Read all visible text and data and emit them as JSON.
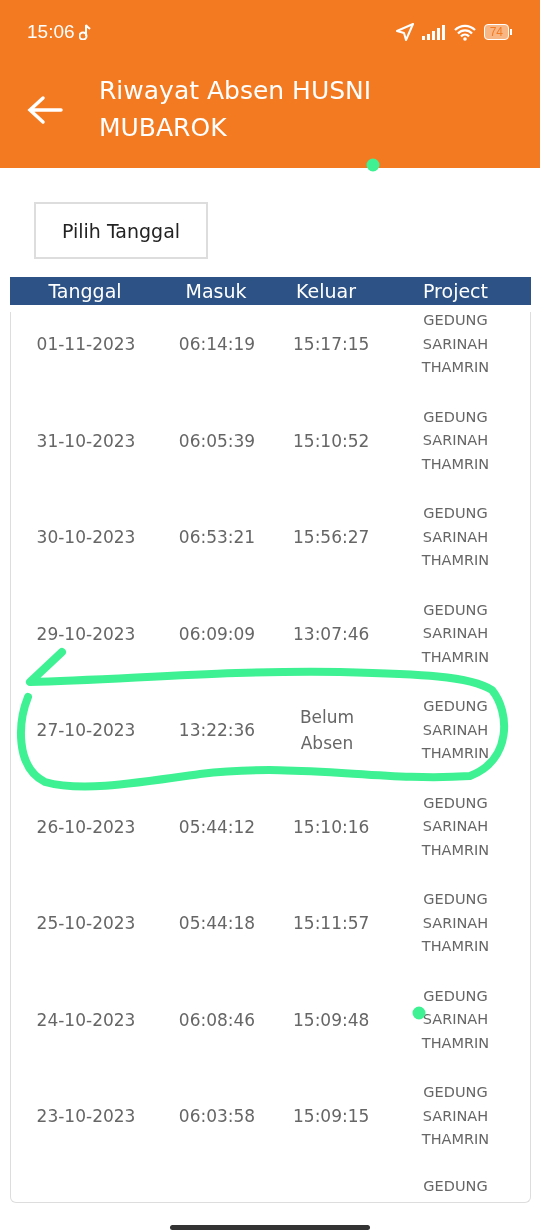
{
  "status_bar": {
    "time": "15:06",
    "battery": "74"
  },
  "header": {
    "title": "Riwayat Absen HUSNI MUBAROK"
  },
  "date_button": {
    "label": "Pilih Tanggal"
  },
  "table": {
    "columns": [
      "Tanggal",
      "Masuk",
      "Keluar",
      "Project"
    ],
    "rows": [
      {
        "date": "01-11-2023",
        "in": "06:14:19",
        "out": "15:17:15",
        "project": "GEDUNG SARINAH THAMRIN"
      },
      {
        "date": "31-10-2023",
        "in": "06:05:39",
        "out": "15:10:52",
        "project": "GEDUNG SARINAH THAMRIN"
      },
      {
        "date": "30-10-2023",
        "in": "06:53:21",
        "out": "15:56:27",
        "project": "GEDUNG SARINAH THAMRIN"
      },
      {
        "date": "29-10-2023",
        "in": "06:09:09",
        "out": "13:07:46",
        "project": "GEDUNG SARINAH THAMRIN"
      },
      {
        "date": "27-10-2023",
        "in": "13:22:36",
        "out": "Belum Absen",
        "project": "GEDUNG SARINAH THAMRIN"
      },
      {
        "date": "26-10-2023",
        "in": "05:44:12",
        "out": "15:10:16",
        "project": "GEDUNG SARINAH THAMRIN"
      },
      {
        "date": "25-10-2023",
        "in": "05:44:18",
        "out": "15:11:57",
        "project": "GEDUNG SARINAH THAMRIN"
      },
      {
        "date": "24-10-2023",
        "in": "06:08:46",
        "out": "15:09:48",
        "project": "GEDUNG SARINAH THAMRIN"
      },
      {
        "date": "23-10-2023",
        "in": "06:03:58",
        "out": "15:09:15",
        "project": "GEDUNG SARINAH THAMRIN"
      },
      {
        "project": "GEDUNG"
      }
    ]
  }
}
